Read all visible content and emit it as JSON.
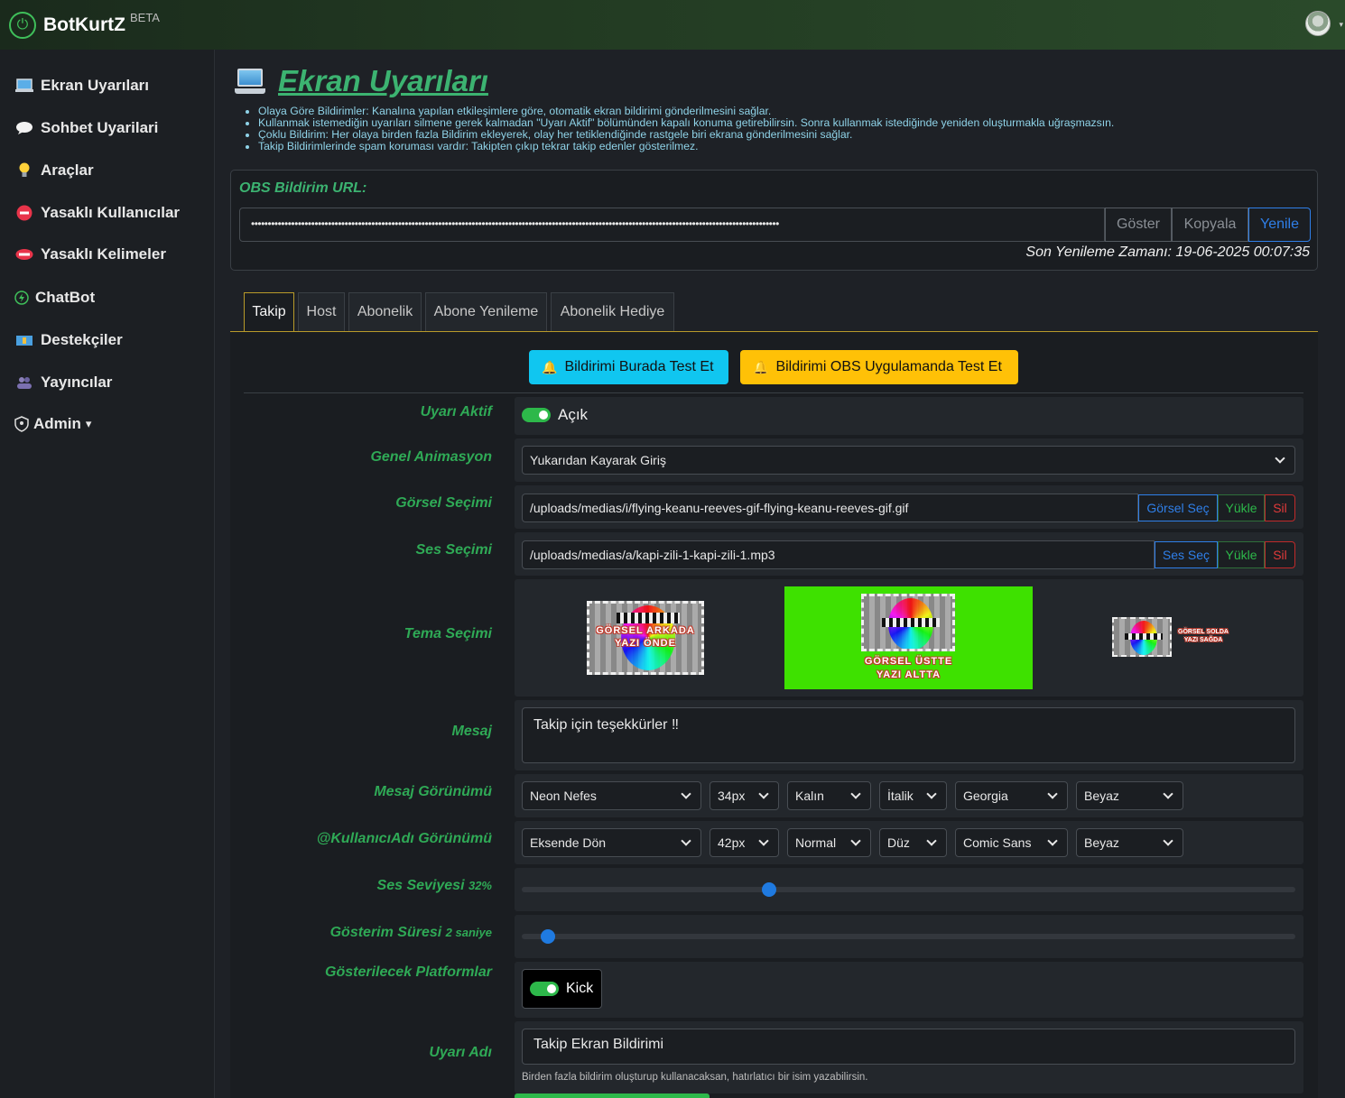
{
  "brand": {
    "name": "BotKurtZ",
    "badge": "BETA",
    "logo_icon": "power-leaf-icon"
  },
  "sidebar": {
    "items": [
      {
        "label": "Ekran Uyarıları",
        "icon": "laptop-icon"
      },
      {
        "label": "Sohbet Uyarilari",
        "icon": "speech-bubble-icon"
      },
      {
        "label": "Araçlar",
        "icon": "lightbulb-icon"
      },
      {
        "label": "Yasaklı Kullanıcılar",
        "icon": "no-entry-icon"
      },
      {
        "label": "Yasaklı Kelimeler",
        "icon": "mouth-icon"
      },
      {
        "label": "ChatBot",
        "icon": "bolt-circle-icon"
      },
      {
        "label": "Destekçiler",
        "icon": "money-icon"
      },
      {
        "label": "Yayıncılar",
        "icon": "people-icon"
      },
      {
        "label": "Admin",
        "icon": "shield-icon",
        "caret": "▾"
      }
    ]
  },
  "page": {
    "title": "Ekran Uyarıları",
    "notes": [
      "Olaya Göre Bildirimler: Kanalına yapılan etkileşimlere göre, otomatik ekran bildirimi gönderilmesini sağlar.",
      "Kullanmak istemediğin uyarıları silmene gerek kalmadan \"Uyarı Aktif\" bölümünden kapalı konuma getirebilirsin. Sonra kullanmak istediğinde yeniden oluşturmakla uğraşmazsın.",
      "Çoklu Bildirim: Her olaya birden fazla Bildirim ekleyerek, olay her tetiklendiğinde rastgele biri ekrana gönderilmesini sağlar.",
      "Takip Bildirimlerinde spam koruması vardır: Takipten çıkıp tekrar takip edenler gösterilmez."
    ]
  },
  "obs": {
    "label": "OBS Bildirim URL:",
    "masked_url": "••••••••••••••••••••••••••••••••••••••••••••••••••••••••••••••••••••••••••••••••••••••••••••••••••••••••••••••••••••••••••••••••••••••••••••••••••••••••••••••",
    "show_label": "Göster",
    "copy_label": "Kopyala",
    "renew_label": "Yenile",
    "last_renew": "Son Yenileme Zamanı: 19-06-2025 00:07:35"
  },
  "tabs": [
    {
      "label": "Takip",
      "active": true
    },
    {
      "label": "Host"
    },
    {
      "label": "Abonelik"
    },
    {
      "label": "Abone Yenileme"
    },
    {
      "label": "Abonelik Hediye"
    }
  ],
  "actions": {
    "test_here": "Bildirimi Burada Test Et",
    "test_obs": "Bildirimi OBS Uygulamanda Test Et",
    "bell_icon": "bell-icon"
  },
  "form": {
    "active": {
      "label": "Uyarı Aktif",
      "value": "Açık",
      "on": true
    },
    "animation": {
      "label": "Genel Animasyon",
      "value": "Yukarıdan Kayarak Giriş"
    },
    "image": {
      "label": "Görsel Seçimi",
      "value": "/uploads/medias/i/flying-keanu-reeves-gif-flying-keanu-reeves-gif.gif",
      "select_label": "Görsel Seç",
      "upload_label": "Yükle",
      "delete_label": "Sil"
    },
    "sound": {
      "label": "Ses Seçimi",
      "value": "/uploads/medias/a/kapi-zili-1-kapi-zili-1.mp3",
      "select_label": "Ses Seç",
      "upload_label": "Yükle",
      "delete_label": "Sil"
    },
    "theme": {
      "label": "Tema Seçimi",
      "options": [
        {
          "line1": "GÖRSEL ARKADA",
          "line2": "YAZI ÖNDE"
        },
        {
          "line1": "GÖRSEL ÜSTTE",
          "line2": "YAZI ALTTA",
          "selected": true,
          "highlight": "#3ee100"
        },
        {
          "line1": "GÖRSEL SOLDA",
          "line2": "YAZI SAĞDA"
        }
      ]
    },
    "message": {
      "label": "Mesaj",
      "value": "Takip için teşekkürler ‼"
    },
    "message_style": {
      "label": "Mesaj Görünümü",
      "animation": "Neon Nefes",
      "size": "34px",
      "weight": "Kalın",
      "style": "İtalik",
      "font": "Georgia",
      "color": "Beyaz"
    },
    "username_style": {
      "label": "@KullanıcıAdı Görünümü",
      "animation": "Eksende Dön",
      "size": "42px",
      "weight": "Normal",
      "style": "Düz",
      "font": "Comic Sans",
      "color": "Beyaz"
    },
    "volume": {
      "label": "Ses Seviyesi",
      "value_text": "32%",
      "value": 32
    },
    "duration": {
      "label": "Gösterim Süresi",
      "value_text": "2 saniye",
      "value": 2,
      "max": 60
    },
    "platforms": {
      "label": "Gösterilecek Platformlar",
      "items": [
        {
          "name": "Kick",
          "on": true
        }
      ]
    },
    "alert_name": {
      "label": "Uyarı Adı",
      "value": "Takip Ekran Bildirimi",
      "help": "Birden fazla bildirim oluşturup kullanacaksan, hatırlatıcı bir isim yazabilirsin."
    }
  },
  "colors": {
    "accent_green": "#3cb371",
    "link_blue": "#2f7fe8",
    "tab_border": "#b89a2a",
    "cyan_button": "#10c6f0",
    "yellow_button": "#ffc107"
  }
}
